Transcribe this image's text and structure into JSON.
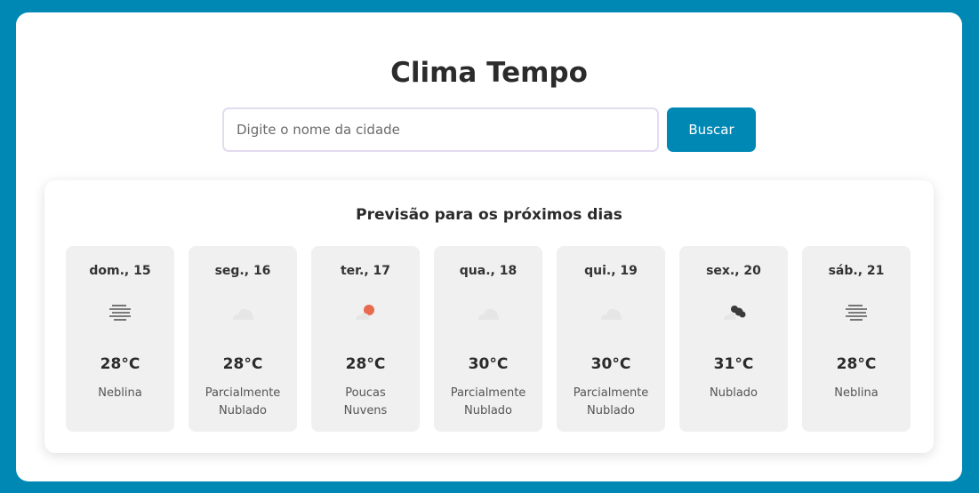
{
  "header": {
    "title": "Clima Tempo"
  },
  "search": {
    "placeholder": "Digite o nome da cidade",
    "value": "",
    "button_label": "Buscar"
  },
  "forecast": {
    "title": "Previsão para os próximos dias",
    "days": [
      {
        "day": "dom., 15",
        "temp": "28°C",
        "desc_line1": "Neblina",
        "desc_line2": "",
        "icon": "fog-icon"
      },
      {
        "day": "seg., 16",
        "temp": "28°C",
        "desc_line1": "Parcialmente",
        "desc_line2": "Nublado",
        "icon": "cloud-icon"
      },
      {
        "day": "ter., 17",
        "temp": "28°C",
        "desc_line1": "Poucas",
        "desc_line2": "Nuvens",
        "icon": "sun-cloud-icon"
      },
      {
        "day": "qua., 18",
        "temp": "30°C",
        "desc_line1": "Parcialmente",
        "desc_line2": "Nublado",
        "icon": "cloud-icon"
      },
      {
        "day": "qui., 19",
        "temp": "30°C",
        "desc_line1": "Parcialmente",
        "desc_line2": "Nublado",
        "icon": "cloud-icon"
      },
      {
        "day": "sex., 20",
        "temp": "31°C",
        "desc_line1": "Nublado",
        "desc_line2": "",
        "icon": "dark-cloud-icon"
      },
      {
        "day": "sáb., 21",
        "temp": "28°C",
        "desc_line1": "Neblina",
        "desc_line2": "",
        "icon": "fog-icon"
      }
    ]
  },
  "colors": {
    "background": "#0088b5",
    "accent": "#0088b5",
    "card": "#f0f0f0",
    "sun": "#e86a4f"
  }
}
